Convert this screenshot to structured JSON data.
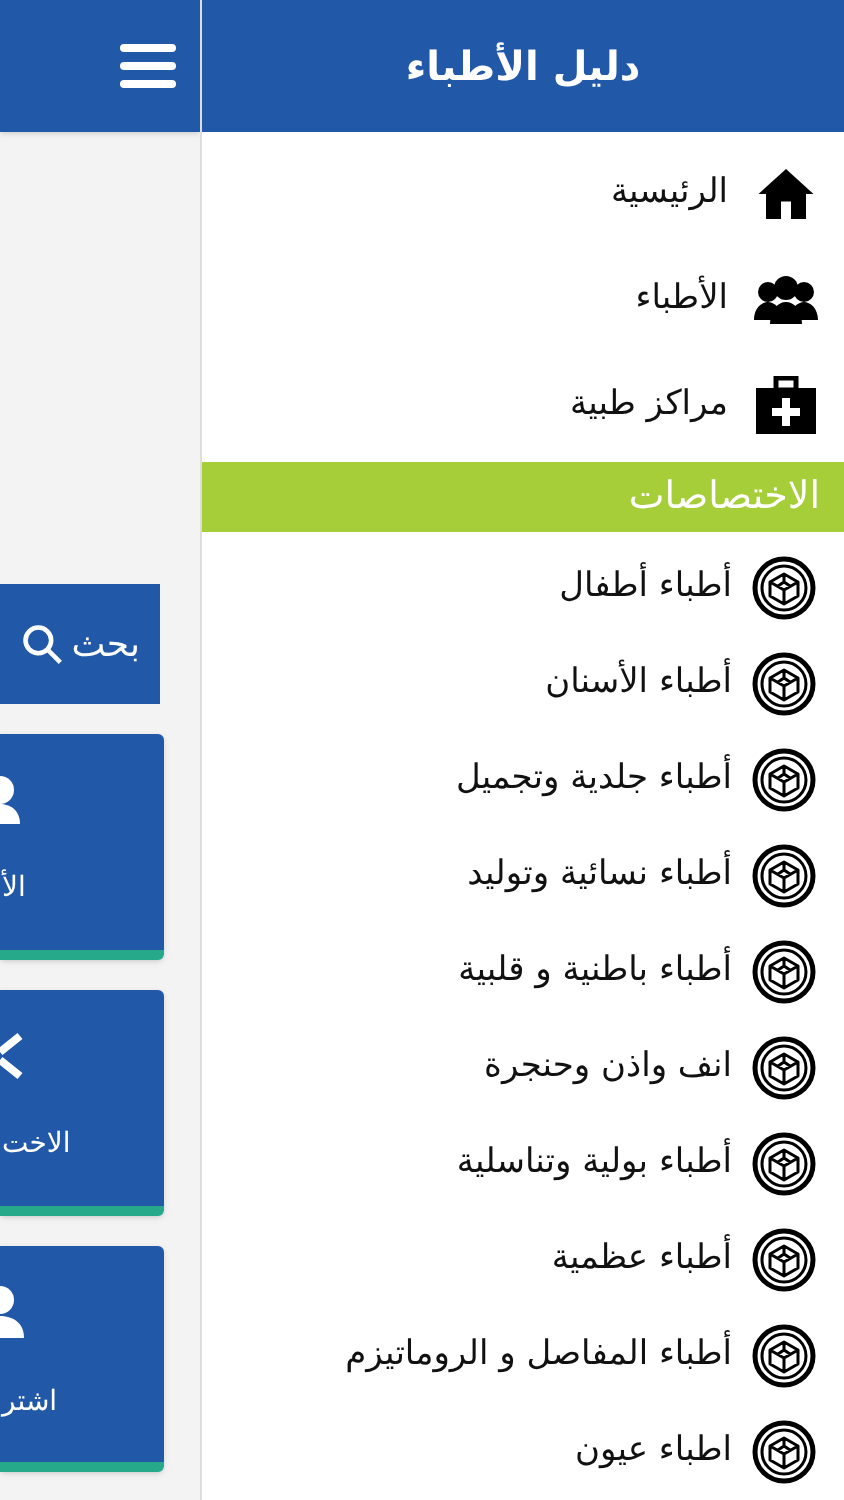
{
  "main": {
    "search_button": "بحث",
    "cards": [
      {
        "label": "الأ",
        "kind": "doctors"
      },
      {
        "label": "الاخت",
        "kind": "specialties"
      },
      {
        "label": "اشتر",
        "kind": "user"
      }
    ]
  },
  "drawer": {
    "title": "دليل الأطباء",
    "menu": [
      {
        "label": "الرئيسية",
        "kind": "home"
      },
      {
        "label": "الأطباء",
        "kind": "doctors"
      },
      {
        "label": "مراكز طبية",
        "kind": "medical"
      }
    ],
    "section_title": "الاختصاصات",
    "specialties": [
      "أطباء أطفال",
      "أطباء الأسنان",
      "أطباء جلدية وتجميل",
      "أطباء نسائية وتوليد",
      "أطباء باطنية و قلبية",
      "انف واذن وحنجرة",
      "أطباء بولية وتناسلية",
      "أطباء عظمية",
      "أطباء المفاصل و الروماتيزم",
      "اطباء عيون"
    ]
  }
}
